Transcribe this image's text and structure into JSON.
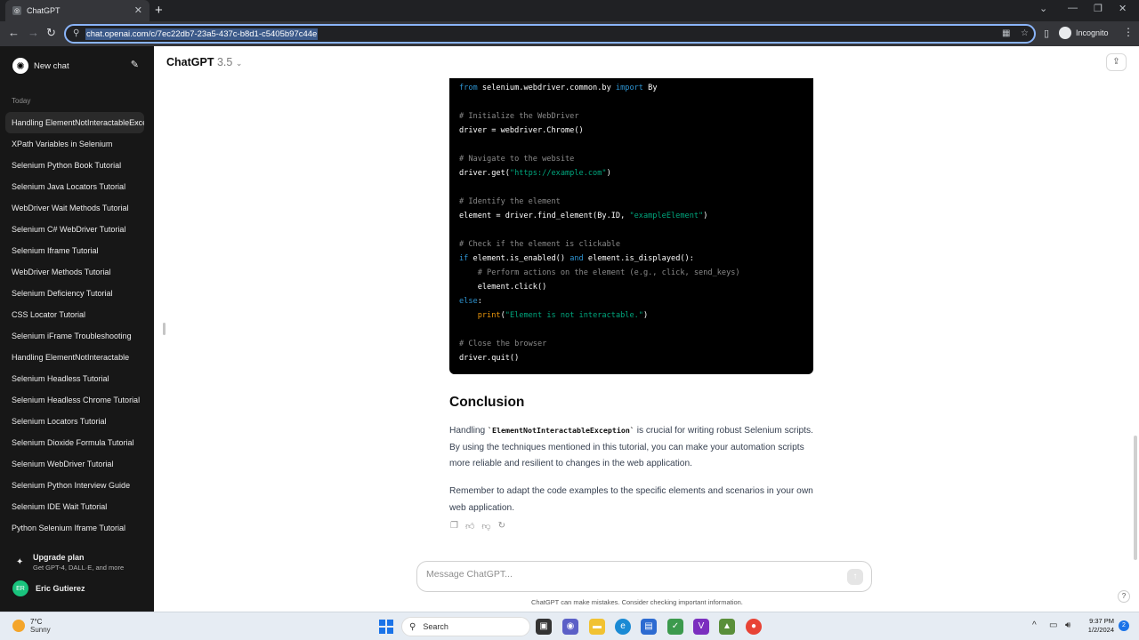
{
  "browser": {
    "tab_title": "ChatGPT",
    "url": "chat.openai.com/c/7ec22db7-23a5-437c-b8d1-c5405b97c44e",
    "incognito_label": "Incognito"
  },
  "sidebar": {
    "new_chat_label": "New chat",
    "section_label": "Today",
    "items": [
      {
        "label": "Handling ElementNotInteractableException"
      },
      {
        "label": "XPath Variables in Selenium"
      },
      {
        "label": "Selenium Python Book Tutorial"
      },
      {
        "label": "Selenium Java Locators Tutorial"
      },
      {
        "label": "WebDriver Wait Methods Tutorial"
      },
      {
        "label": "Selenium C# WebDriver Tutorial"
      },
      {
        "label": "Selenium Iframe Tutorial"
      },
      {
        "label": "WebDriver Methods Tutorial"
      },
      {
        "label": "Selenium Deficiency Tutorial"
      },
      {
        "label": "CSS Locator Tutorial"
      },
      {
        "label": "Selenium iFrame Troubleshooting"
      },
      {
        "label": "Handling ElementNotInteractable"
      },
      {
        "label": "Selenium Headless Tutorial"
      },
      {
        "label": "Selenium Headless Chrome Tutorial"
      },
      {
        "label": "Selenium Locators Tutorial"
      },
      {
        "label": "Selenium Dioxide Formula Tutorial"
      },
      {
        "label": "Selenium WebDriver Tutorial"
      },
      {
        "label": "Selenium Python Interview Guide"
      },
      {
        "label": "Selenium IDE Wait Tutorial"
      },
      {
        "label": "Python Selenium Iframe Tutorial"
      }
    ],
    "upgrade_title": "Upgrade plan",
    "upgrade_subtitle": "Get GPT-4, DALL·E, and more",
    "user_initials": "ER",
    "user_name": "Eric Gutierez"
  },
  "header": {
    "model_name": "ChatGPT",
    "model_version": "3.5"
  },
  "code": {
    "lines": [
      "from selenium.webdriver.common.by import By",
      "",
      "# Initialize the WebDriver",
      "driver = webdriver.Chrome()",
      "",
      "# Navigate to the website",
      "driver.get(\"https://example.com\")",
      "",
      "# Identify the element",
      "element = driver.find_element(By.ID, \"exampleElement\")",
      "",
      "# Check if the element is clickable",
      "if element.is_enabled() and element.is_displayed():",
      "    # Perform actions on the element (e.g., click, send_keys)",
      "    element.click()",
      "else:",
      "    print(\"Element is not interactable.\")",
      "",
      "# Close the browser",
      "driver.quit()"
    ]
  },
  "message": {
    "heading": "Conclusion",
    "para1_before": "Handling ",
    "para1_code": "`ElementNotInteractableException`",
    "para1_after": " is crucial for writing robust Selenium scripts. By using the techniques mentioned in this tutorial, you can make your automation scripts more reliable and resilient to changes in the web application.",
    "para2": "Remember to adapt the code examples to the specific elements and scenarios in your own web application."
  },
  "composer": {
    "placeholder": "Message ChatGPT...",
    "disclaimer": "ChatGPT can make mistakes. Consider checking important information."
  },
  "taskbar": {
    "temperature": "7°C",
    "condition": "Sunny",
    "search_label": "Search",
    "time": "9:37 PM",
    "date": "1/2/2024",
    "notification_count": "2"
  }
}
